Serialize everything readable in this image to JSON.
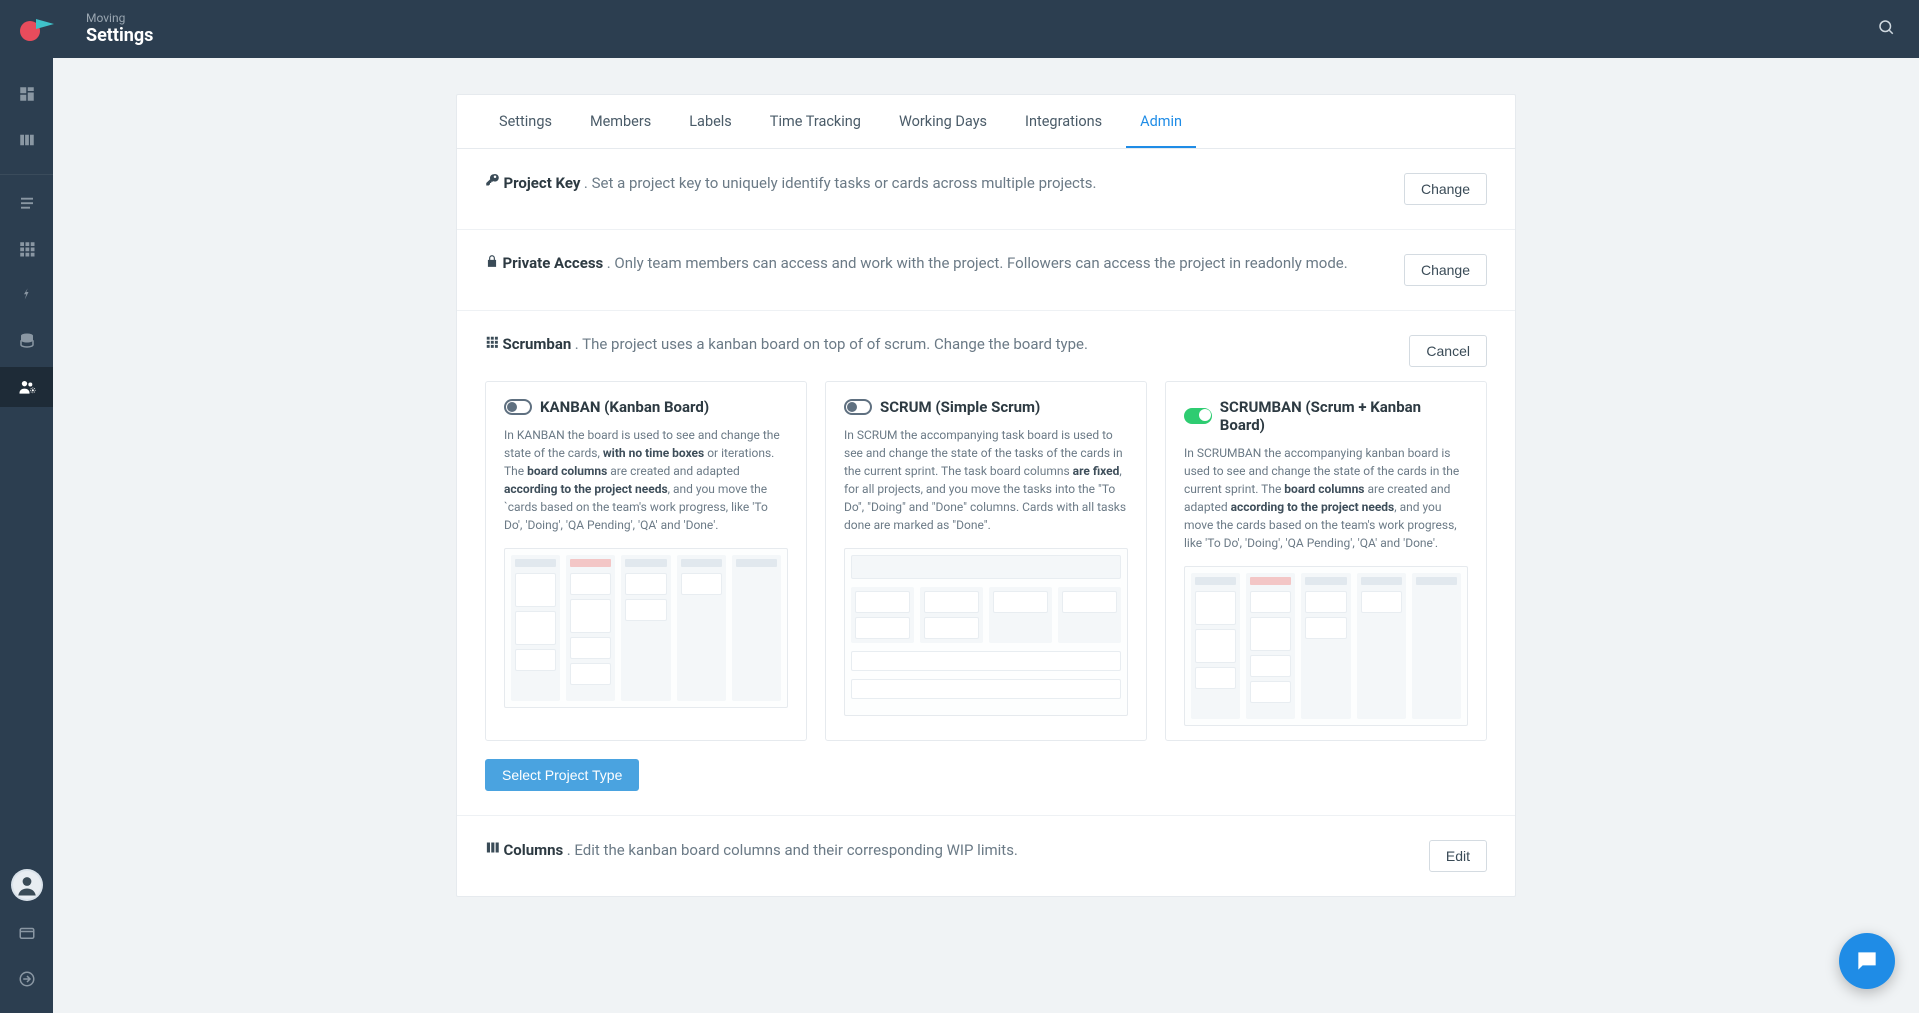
{
  "header": {
    "context": "Moving",
    "title": "Settings"
  },
  "tabs": [
    "Settings",
    "Members",
    "Labels",
    "Time Tracking",
    "Working Days",
    "Integrations",
    "Admin"
  ],
  "active_tab": "Admin",
  "project_key": {
    "label": "Project Key",
    "desc": ". Set a project key to uniquely identify tasks or cards across multiple projects.",
    "action": "Change"
  },
  "private_access": {
    "label": "Private Access",
    "desc": ". Only team members can access and work with the project. Followers can access the project in readonly mode.",
    "action": "Change"
  },
  "scrumban": {
    "label": "Scrumban",
    "desc": ". The project uses a kanban board on top of of scrum. Change the board type.",
    "action": "Cancel"
  },
  "cards": {
    "kanban": {
      "title": "KANBAN (Kanban Board)",
      "desc_parts": [
        "In KANBAN the board is used to see and change the state of the cards, ",
        "with no time boxes",
        " or iterations. The ",
        "board columns",
        " are created and adapted ",
        "according to the project needs",
        ", and you move the `cards based on the team's work progress, like 'To Do', 'Doing', 'QA Pending', 'QA' and 'Done'."
      ]
    },
    "scrum": {
      "title": "SCRUM (Simple Scrum)",
      "desc_parts": [
        "In SCRUM the accompanying task board is used to see and change the state of the tasks of the cards in the current sprint. The task board columns ",
        "are fixed",
        ", for all projects, and you move the tasks into the \"To Do\", \"Doing\" and \"Done\" columns. Cards with all tasks done are marked as \"Done\"."
      ]
    },
    "scrumban": {
      "title": "SCRUMBAN (Scrum + Kanban Board)",
      "desc_parts": [
        "In SCRUMBAN the accompanying kanban board is used to see and change the state of the cards in the current sprint. The ",
        "board columns",
        " are created and adapted ",
        "according to the project needs",
        ", and you move the cards based on the team's work progress, like 'To Do', 'Doing', 'QA Pending', 'QA' and 'Done'."
      ]
    }
  },
  "select_project_type": "Select Project Type",
  "columns": {
    "label": "Columns",
    "desc": ". Edit the kanban board columns and their corresponding WIP limits.",
    "action": "Edit"
  }
}
